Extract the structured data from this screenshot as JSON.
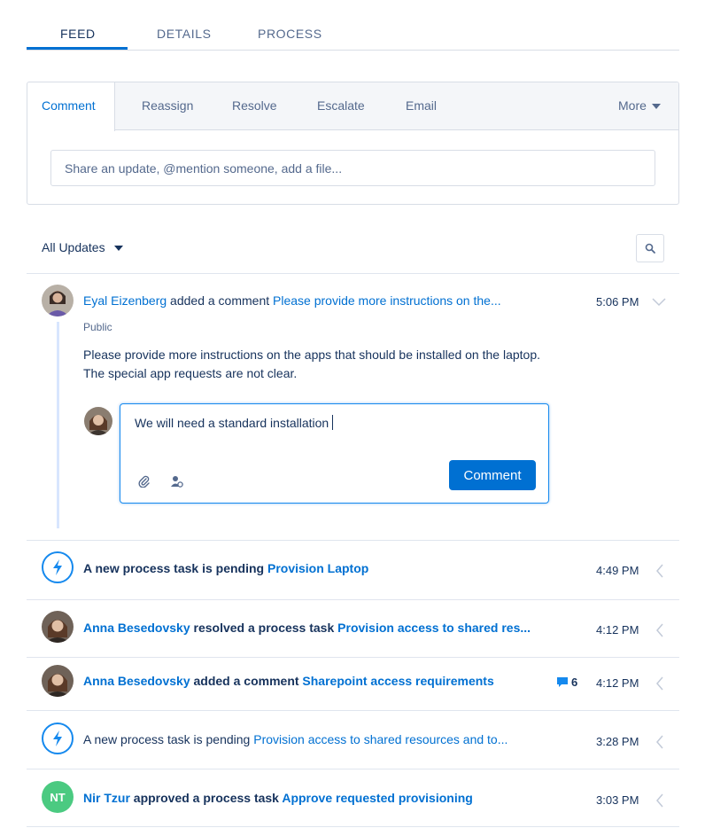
{
  "top_tabs": [
    "FEED",
    "DETAILS",
    "PROCESS"
  ],
  "publisher": {
    "tabs": [
      "Comment",
      "Reassign",
      "Resolve",
      "Escalate",
      "Email"
    ],
    "more_label": "More",
    "placeholder": "Share an update, @mention someone, add a file..."
  },
  "filter": {
    "label": "All Updates"
  },
  "items": [
    {
      "actor": "Eyal Eizenberg",
      "action": " added a comment ",
      "target": "Please provide more instructions on the...",
      "time": "5:06 PM",
      "visibility": "Public",
      "body": "Please provide more instructions on the apps that should be installed on the laptop. The special app requests are not clear.",
      "reply_text": "We will need a standard installation",
      "reply_button": "Comment"
    },
    {
      "action": "A new process task is pending ",
      "target": "Provision Laptop",
      "time": "4:49 PM"
    },
    {
      "actor": "Anna Besedovsky",
      "action": " resolved a process task ",
      "target": "Provision access to shared res...",
      "time": "4:12 PM"
    },
    {
      "actor": "Anna Besedovsky",
      "action": " added a comment ",
      "target": "Sharepoint access requirements",
      "comment_count": "6",
      "time": "4:12 PM"
    },
    {
      "action": "A new process task is pending ",
      "target": "Provision access to shared resources and to...",
      "time": "3:28 PM"
    },
    {
      "initials": "NT",
      "actor": "Nir Tzur",
      "action": " approved a process task ",
      "target": "Approve requested provisioning",
      "time": "3:03 PM"
    }
  ],
  "colors": {
    "brand": "#0070d2",
    "success": "#4bca81"
  }
}
